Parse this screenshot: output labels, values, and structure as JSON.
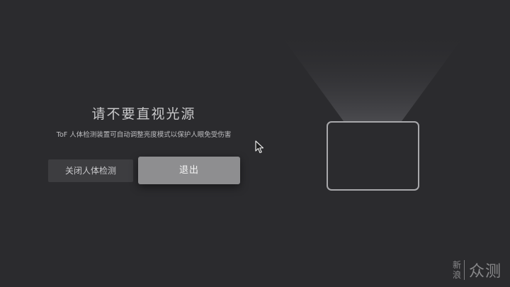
{
  "dialog": {
    "title": "请不要直视光源",
    "subtitle": "ToF 人体检测装置可自动调整亮度模式以保护人眼免受伤害",
    "disable_button_label": "关闭人体检测",
    "exit_button_label": "退出"
  },
  "illustration": {
    "icon": "projector-beam-screen-icon"
  },
  "cursor": {
    "icon": "mouse-pointer-icon"
  },
  "watermark": {
    "chars_left": [
      "新",
      "浪"
    ],
    "text_right": "众测"
  },
  "colors": {
    "background": "#2b2b2e",
    "exit_button": "#8e8e90",
    "disable_button": "#3d3d40",
    "outline": "#a8a8ab"
  }
}
